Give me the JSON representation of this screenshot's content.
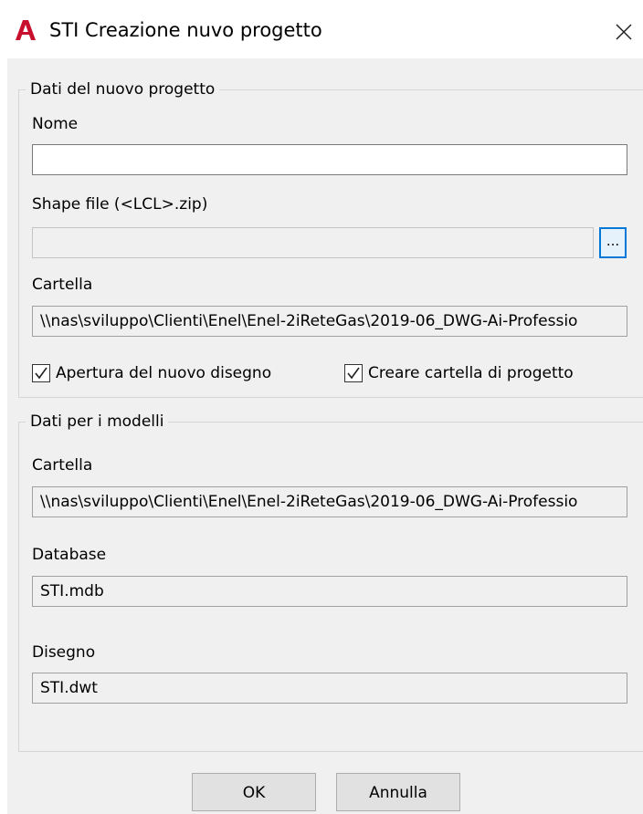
{
  "window": {
    "title": "STI Creazione nuvo progetto",
    "app_icon": "autocad-icon",
    "close_icon": "close-icon"
  },
  "group_new_project": {
    "legend": "Dati del nuovo progetto",
    "name_label": "Nome",
    "name_value": "",
    "shape_label": "Shape file (<LCL>.zip)",
    "shape_value": "",
    "browse_label": "...",
    "folder_label": "Cartella",
    "folder_value": "\\\\nas\\sviluppo\\Clienti\\Enel\\Enel-2iReteGas\\2019-06_DWG-Ai-Professio",
    "open_new_drawing": {
      "label": "Apertura del nuovo disegno",
      "checked": true
    },
    "create_project_folder": {
      "label": "Creare cartella di progetto",
      "checked": true
    }
  },
  "group_models": {
    "legend": "Dati per i modelli",
    "folder_label": "Cartella",
    "folder_value": "\\\\nas\\sviluppo\\Clienti\\Enel\\Enel-2iReteGas\\2019-06_DWG-Ai-Professio",
    "database_label": "Database",
    "database_value": "STI.mdb",
    "drawing_label": "Disegno",
    "drawing_value": "STI.dwt"
  },
  "buttons": {
    "ok": "OK",
    "cancel": "Annulla"
  },
  "colors": {
    "dialog_background": "#f0f0f0",
    "app_icon_red": "#c8102e",
    "focus_blue": "#0078d7"
  }
}
